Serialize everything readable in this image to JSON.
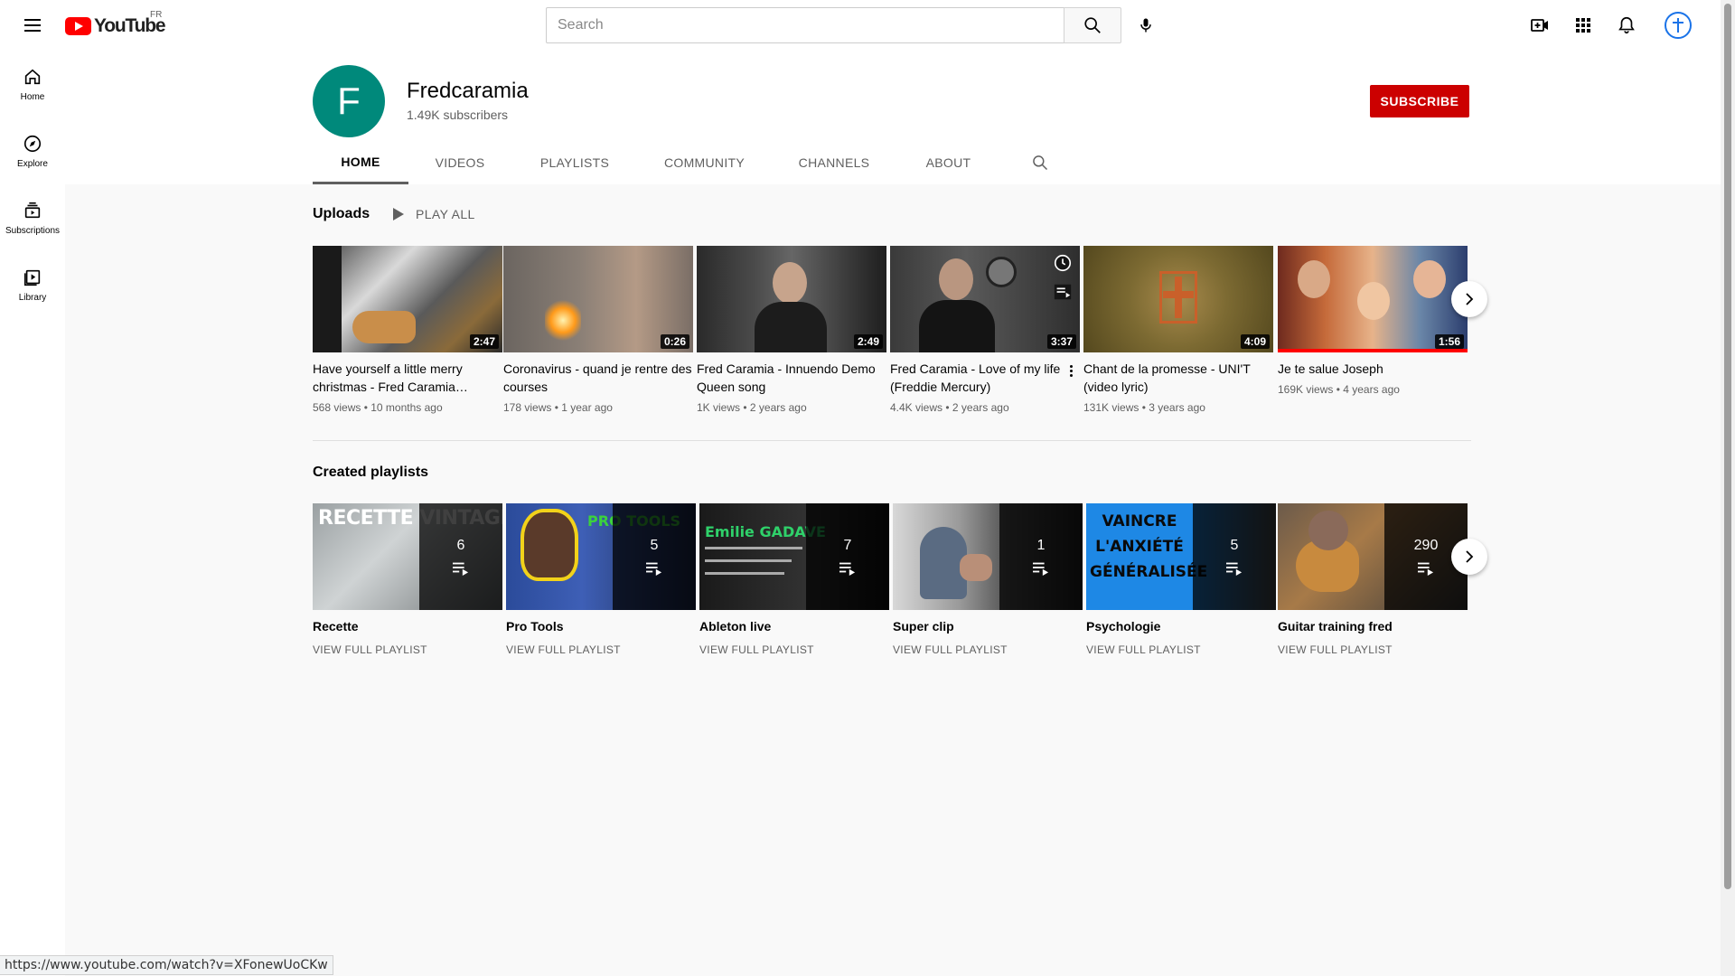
{
  "masthead": {
    "logo_text": "YouTube",
    "country": "FR",
    "search_placeholder": "Search"
  },
  "guide": {
    "items": [
      {
        "label": "Home",
        "icon": "home-icon"
      },
      {
        "label": "Explore",
        "icon": "compass-icon"
      },
      {
        "label": "Subscriptions",
        "icon": "subscriptions-icon"
      },
      {
        "label": "Library",
        "icon": "library-icon"
      }
    ]
  },
  "channel": {
    "avatar_letter": "F",
    "avatar_color": "#00897b",
    "title": "Fredcaramia",
    "subscribers": "1.49K subscribers",
    "subscribe_label": "SUBSCRIBE",
    "tabs": [
      "HOME",
      "VIDEOS",
      "PLAYLISTS",
      "COMMUNITY",
      "CHANNELS",
      "ABOUT"
    ]
  },
  "uploads": {
    "title": "Uploads",
    "play_all": "PLAY ALL",
    "videos": [
      {
        "title": "Have yourself a little merry christmas - Fred Caramia…",
        "views": "568 views",
        "age": "10 months ago",
        "duration": "2:47"
      },
      {
        "title": "Coronavirus - quand je rentre des courses",
        "views": "178 views",
        "age": "1 year ago",
        "duration": "0:26"
      },
      {
        "title": "Fred Caramia - Innuendo Demo Queen song",
        "views": "1K views",
        "age": "2 years ago",
        "duration": "2:49"
      },
      {
        "title": "Fred Caramia - Love of my life (Freddie Mercury)",
        "views": "4.4K views",
        "age": "2 years ago",
        "duration": "3:37"
      },
      {
        "title": "Chant de la promesse - UNI'T (video lyric)",
        "views": "131K views",
        "age": "3 years ago",
        "duration": "4:09"
      },
      {
        "title": "Je te salue Joseph",
        "views": "169K views",
        "age": "4 years ago",
        "duration": "1:56"
      }
    ]
  },
  "playlists": {
    "title": "Created playlists",
    "items": [
      {
        "title": "Recette",
        "count": "6",
        "link": "VIEW FULL PLAYLIST",
        "thumb_text": "RECETTE VINTAGE"
      },
      {
        "title": "Pro Tools",
        "count": "5",
        "link": "VIEW FULL PLAYLIST",
        "thumb_text": "PRO TOOLS"
      },
      {
        "title": "Ableton live",
        "count": "7",
        "link": "VIEW FULL PLAYLIST",
        "thumb_text": "Emilie GADAVE"
      },
      {
        "title": "Super clip",
        "count": "1",
        "link": "VIEW FULL PLAYLIST",
        "thumb_text": ""
      },
      {
        "title": "Psychologie",
        "count": "5",
        "link": "VIEW FULL PLAYLIST",
        "thumb_text": "VAINCRE L'ANXIÉTÉ GÉNÉRALISÉE"
      },
      {
        "title": "Guitar training fred",
        "count": "290",
        "link": "VIEW FULL PLAYLIST",
        "thumb_text": ""
      }
    ]
  },
  "status_bar": {
    "url": "https://www.youtube.com/watch?v=XFonewUoCKw"
  },
  "colors": {
    "brand_red": "#ff0000",
    "subscribe_red": "#cc0000",
    "background": "#f9f9f9"
  }
}
